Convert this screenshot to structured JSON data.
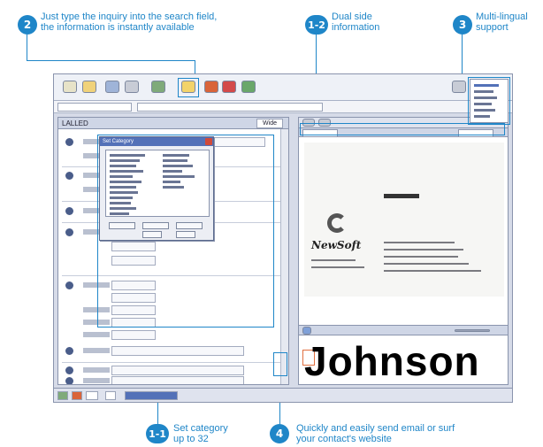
{
  "callouts": {
    "c2": {
      "badge": "2",
      "line1": "Just type the inquiry into the search field,",
      "line2": "the information is instantly available"
    },
    "c12": {
      "badge": "1-2",
      "line1": "Dual side",
      "line2": "information"
    },
    "c3": {
      "badge": "3",
      "line1": "Multi-lingual",
      "line2": "support"
    },
    "c11": {
      "badge": "1-1",
      "line1": "Set category",
      "line2": "up to 32"
    },
    "c4": {
      "badge": "4",
      "line1": "Quickly and easily send email or surf",
      "line2": "your contact's website"
    }
  },
  "app": {
    "list_title": "LALLED",
    "wide_label": "Wide",
    "popup_title": "Set Category",
    "popup_buttons": [
      "",
      "",
      ""
    ],
    "card": {
      "brand": "",
      "company": "",
      "logo_text": "NewSoft"
    },
    "signature_text": "Johnson"
  },
  "colors": {
    "accent": "#1f86c8",
    "window_bg": "#d6dbe8"
  }
}
